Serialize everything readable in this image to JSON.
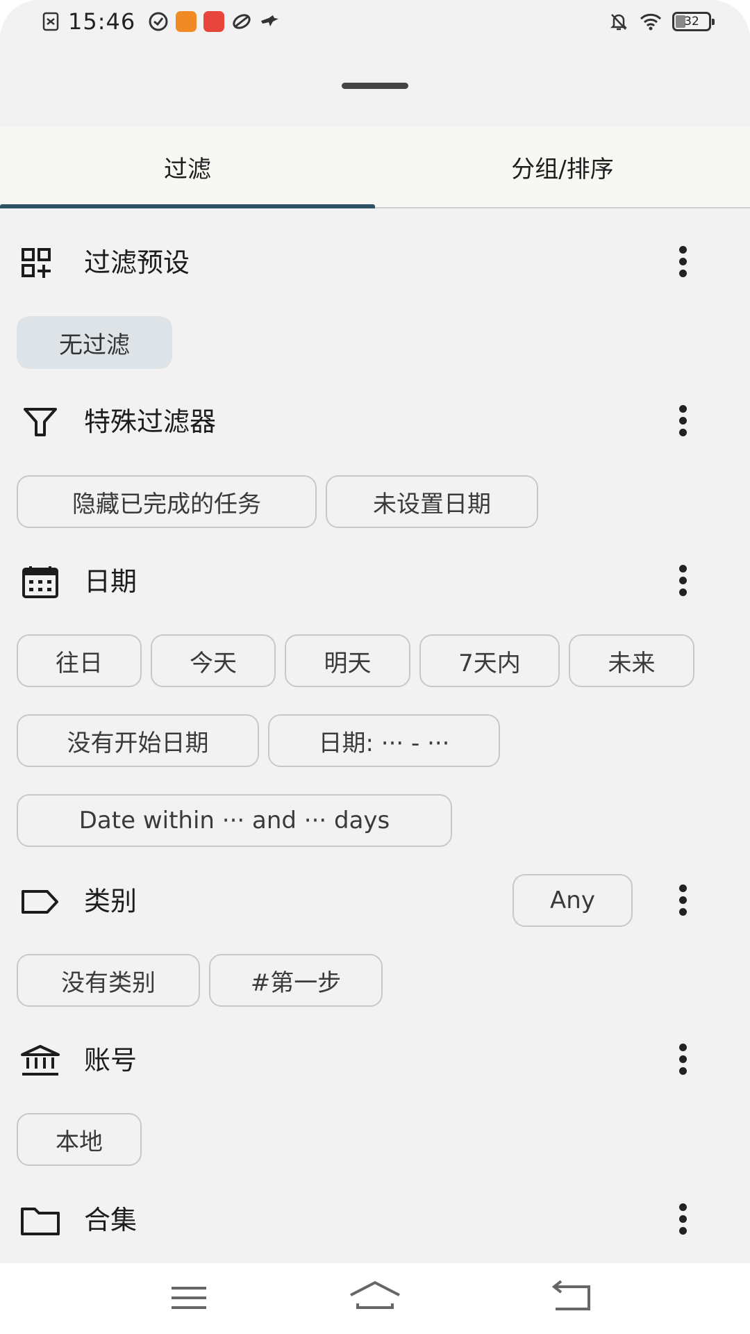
{
  "status_bar": {
    "time": "15:46",
    "battery": "32",
    "icons_left": [
      "sim-icon",
      "clock-app-icon",
      "app-icon-orange",
      "app-icon-red",
      "link-icon",
      "bird-icon"
    ],
    "icons_right": [
      "notifications-off-icon",
      "wifi-icon",
      "battery-icon"
    ]
  },
  "tabs": [
    {
      "label": "过滤",
      "selected": true
    },
    {
      "label": "分组/排序",
      "selected": false
    }
  ],
  "sections": {
    "presets": {
      "title": "过滤预设",
      "icon": "add-grid-icon",
      "chips": [
        "无过滤"
      ]
    },
    "special": {
      "title": "特殊过滤器",
      "icon": "filter-icon",
      "chips": [
        "隐藏已完成的任务",
        "未设置日期"
      ]
    },
    "date": {
      "title": "日期",
      "icon": "calendar-icon",
      "chips": [
        "往日",
        "今天",
        "明天",
        "7天内",
        "未来",
        "没有开始日期",
        "日期: ··· - ···",
        "Date within ··· and ··· days"
      ]
    },
    "category": {
      "title": "类别",
      "icon": "label-icon",
      "match": "Any",
      "chips": [
        "没有类别",
        "#第一步"
      ]
    },
    "account": {
      "title": "账号",
      "icon": "bank-icon",
      "chips": [
        "本地"
      ]
    },
    "collection": {
      "title": "合集",
      "icon": "folder-icon"
    }
  },
  "colors": {
    "accent": "#2f5164",
    "chip_selected_bg": "#dde3e6",
    "chip_border": "#c7c9c7",
    "background": "#f2f2f2"
  },
  "nav_bar": {
    "icons": [
      "menu-icon",
      "home-icon",
      "back-icon"
    ]
  }
}
